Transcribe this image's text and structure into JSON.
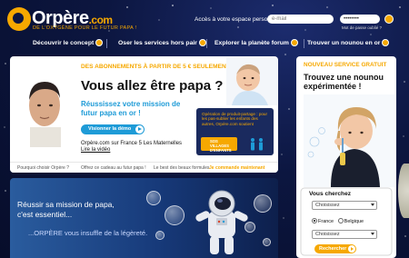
{
  "brand": {
    "logo_text": "Orpère",
    "logo_suffix": ".com",
    "tagline": "DE L'OXYGÈNE POUR LE FUTUR PAPA !"
  },
  "login": {
    "label": "Accès à votre espace personnel",
    "email_placeholder": "e-mail",
    "password_value": "••••••••",
    "forgot_label": "Mot de passe oublié ?"
  },
  "nav": {
    "items": [
      {
        "label": "Découvrir le concept"
      },
      {
        "label": "Oser les services hors pair"
      },
      {
        "label": "Explorer la planète forum"
      },
      {
        "label": "Trouver un nounou en or"
      }
    ]
  },
  "main": {
    "promo_heading": "DES ABONNEMENTS À PARTIR DE 5 € SEULEMENT",
    "title": "Vous allez être papa ?",
    "mission": "Réussissez votre mission de futur papa en or !",
    "demo_button": "Visionner la démo",
    "tv_line": "Orpère.com sur France 5 Les Maternelles",
    "tv_link": "Lire la vidéo",
    "partner_text": "Opération de produit-partage : pour les pas-sublier les enfants des autres, Orpère.com soutient",
    "sos_logo": "SOS VILLAGES D'ENFANTS",
    "links": [
      {
        "label": "Pourquoi choisir Orpère ?"
      },
      {
        "label": "Offrez ce cadeau au futur papa !"
      },
      {
        "label": "Le best des beaux formules"
      },
      {
        "label": "Je commande maintenant"
      }
    ]
  },
  "bottom": {
    "line1": "Réussir sa mission de papa,",
    "line2": "c'est essentiel...",
    "line3": "...ORPÈRE vous insuffle de la légèreté."
  },
  "right": {
    "tag": "NOUVEAU SERVICE GRATUIT",
    "title": "Trouvez une nounou expérimentée !",
    "search_label": "Vous cherchez",
    "select1": "Choisissez",
    "select2": "Choisissez",
    "radio_france": "France",
    "radio_belgique": "Belgique",
    "search_button": "Rechercher"
  },
  "colors": {
    "accent": "#f6a800",
    "blue": "#1e9bd7",
    "navy": "#0c1640"
  }
}
